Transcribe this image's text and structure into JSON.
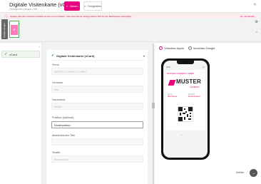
{
  "header": {
    "title": "Digitale Visitenkarte (vCard)",
    "subtitle": "Visitenkarten-Designe • 983",
    "save_label": "Sichern",
    "done_label": "Fertigstellen"
  },
  "info_bar": {
    "text": "Hinweis: Bei den Vorschau handelt es sich um ein Modell – Das Ausmaß von Design ändert sich bei der Bearbeitung womöglich.",
    "link": "Ok, verstanden"
  },
  "side_tab": "Designvorlagen",
  "sidebar": {
    "items": [
      {
        "label": "vCard"
      }
    ]
  },
  "form": {
    "section_title": "Digitale Visitenkarte (vCard)",
    "fields": [
      {
        "label": "Firma",
        "value": "MUSTER COMPANY GMBH"
      },
      {
        "label": "Vorname",
        "value": "Max"
      },
      {
        "label": "Nachname",
        "value": "Muster"
      },
      {
        "label": "Position (optional)",
        "value": "Musterposition"
      },
      {
        "label": "Akademischer Titel",
        "value": ""
      },
      {
        "label": "Straße",
        "value": "Musterstraße"
      }
    ]
  },
  "preview": {
    "radio_apple": "Vorschau Apple",
    "radio_google": "Vorschau Google",
    "phone": {
      "status": "9:41",
      "card_name": "MUSTER COMPANY GMBH",
      "logo": "MUSTER",
      "logo_sub": "COMPANY",
      "name_key": "Name",
      "name_val": "Max Muster",
      "pos_key": "Position",
      "pos_val": "Musterposition",
      "pager": "• • •"
    },
    "next_label": "Weiter"
  },
  "colors": {
    "accent": "#e6007e",
    "success": "#4caf50"
  }
}
